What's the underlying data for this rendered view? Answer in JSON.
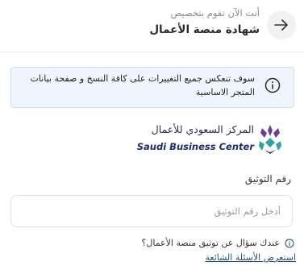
{
  "header": {
    "subtitle": "أنت الآن تقوم بتخصيص",
    "title": "شهادة منصة الأعمال",
    "back_icon": "arrow-right-icon"
  },
  "notice": {
    "icon": "info-circle-icon",
    "text": "سوف تنعكس جميع التغييرات على كافة النسخ و صفحة بيانات المتجر الاساسية"
  },
  "logo": {
    "arabic": "المركز السعودي للأعمال",
    "english": "Saudi Business Center",
    "colors": {
      "dark": "#2a2a5a",
      "teal": "#2aa8a0",
      "purple": "#6c3f95"
    }
  },
  "form": {
    "label": "رقم التوثيق",
    "placeholder": "أدخل رقم التوثيق",
    "value": ""
  },
  "faq": {
    "icon": "info-circle-icon",
    "question": "عندك سؤال عن توثيق منصة الأعمال؟",
    "link": "استعرض الأسئلة الشائعة"
  },
  "colors": {
    "accent_link": "#1f4f7a",
    "notice_bg": "#eef5fc",
    "notice_border": "#cfe1f6"
  }
}
